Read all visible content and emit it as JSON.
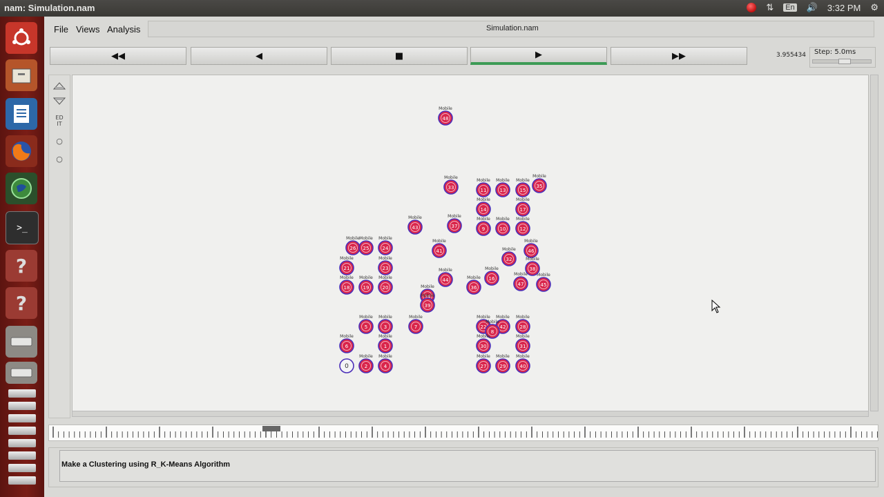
{
  "window_title": "nam: Simulation.nam",
  "system_tray": {
    "lang": "En",
    "clock": "3:32 PM"
  },
  "menu": {
    "file": "File",
    "views": "Views",
    "analysis": "Analysis"
  },
  "filename": "Simulation.nam",
  "controls": {
    "rewind": "◀◀",
    "back": "◀",
    "stop": "■",
    "play": "▶",
    "fast_forward": "▶▶"
  },
  "time_value": "3.955434",
  "step_label": "Step: 5.0ms",
  "annotation": "Make a Clustering using R_K-Means Algorithm",
  "colors": {
    "node_ring": "#4b2fb8",
    "node_fill": "#d9264c",
    "node_fill_light": "#f3f3f6",
    "play_bar": "#3d9b56"
  },
  "nodes": [
    {
      "id": "48",
      "label": "Mobile",
      "fill": "red"
    },
    {
      "id": "33",
      "label": "Mobile",
      "fill": "red"
    },
    {
      "id": "11",
      "label": "Mobile",
      "fill": "red"
    },
    {
      "id": "13",
      "label": "Mobile",
      "fill": "red"
    },
    {
      "id": "15",
      "label": "Mobile",
      "fill": "red"
    },
    {
      "id": "35",
      "label": "Mobile",
      "fill": "red"
    },
    {
      "id": "14",
      "label": "Mobile",
      "fill": "red"
    },
    {
      "id": "17",
      "label": "Mobile",
      "fill": "red"
    },
    {
      "id": "43",
      "label": "Mobile",
      "fill": "red"
    },
    {
      "id": "37",
      "label": "Mobile",
      "fill": "red"
    },
    {
      "id": "9",
      "label": "Mobile",
      "fill": "red"
    },
    {
      "id": "10",
      "label": "Mobile",
      "fill": "red"
    },
    {
      "id": "12",
      "label": "Mobile",
      "fill": "red"
    },
    {
      "id": "26",
      "label": "Mobile",
      "fill": "red"
    },
    {
      "id": "25",
      "label": "Mobile",
      "fill": "red"
    },
    {
      "id": "24",
      "label": "Mobile",
      "fill": "red"
    },
    {
      "id": "41",
      "label": "Mobile",
      "fill": "red"
    },
    {
      "id": "46",
      "label": "Mobile",
      "fill": "red"
    },
    {
      "id": "32",
      "label": "Mobile",
      "fill": "red"
    },
    {
      "id": "21",
      "label": "Mobile",
      "fill": "red"
    },
    {
      "id": "23",
      "label": "Mobile",
      "fill": "red"
    },
    {
      "id": "44",
      "label": "Mobile",
      "fill": "red"
    },
    {
      "id": "18",
      "label": "Mobile",
      "fill": "red"
    },
    {
      "id": "19",
      "label": "Mobile",
      "fill": "red"
    },
    {
      "id": "20",
      "label": "Mobile",
      "fill": "red"
    },
    {
      "id": "34",
      "label": "Mobile",
      "fill": "red"
    },
    {
      "id": "36",
      "label": "Mobile",
      "fill": "red"
    },
    {
      "id": "16",
      "label": "Mobile",
      "fill": "red"
    },
    {
      "id": "47",
      "label": "Mobile",
      "fill": "red"
    },
    {
      "id": "45",
      "label": "Mobile",
      "fill": "red"
    },
    {
      "id": "38",
      "label": "Mobile",
      "fill": "red"
    },
    {
      "id": "39",
      "label": "Mobile",
      "fill": "red"
    },
    {
      "id": "5",
      "label": "Mobile",
      "fill": "red"
    },
    {
      "id": "3",
      "label": "Mobile",
      "fill": "red"
    },
    {
      "id": "7",
      "label": "Mobile",
      "fill": "red"
    },
    {
      "id": "6",
      "label": "Mobile",
      "fill": "red"
    },
    {
      "id": "22",
      "label": "Mobile",
      "fill": "red"
    },
    {
      "id": "42",
      "label": "Mobile",
      "fill": "red"
    },
    {
      "id": "28",
      "label": "Mobile",
      "fill": "red"
    },
    {
      "id": "8",
      "label": "Mobile",
      "fill": "red"
    },
    {
      "id": "1",
      "label": "Mobile",
      "fill": "red"
    },
    {
      "id": "30",
      "label": "Mobile",
      "fill": "red"
    },
    {
      "id": "31",
      "label": "Mobile",
      "fill": "red"
    },
    {
      "id": "0",
      "label": "",
      "fill": "white"
    },
    {
      "id": "2",
      "label": "Mobile",
      "fill": "red"
    },
    {
      "id": "4",
      "label": "Mobile",
      "fill": "red"
    },
    {
      "id": "27",
      "label": "Mobile",
      "fill": "red"
    },
    {
      "id": "29",
      "label": "Mobile",
      "fill": "red"
    },
    {
      "id": "40",
      "label": "Mobile",
      "fill": "red"
    }
  ]
}
